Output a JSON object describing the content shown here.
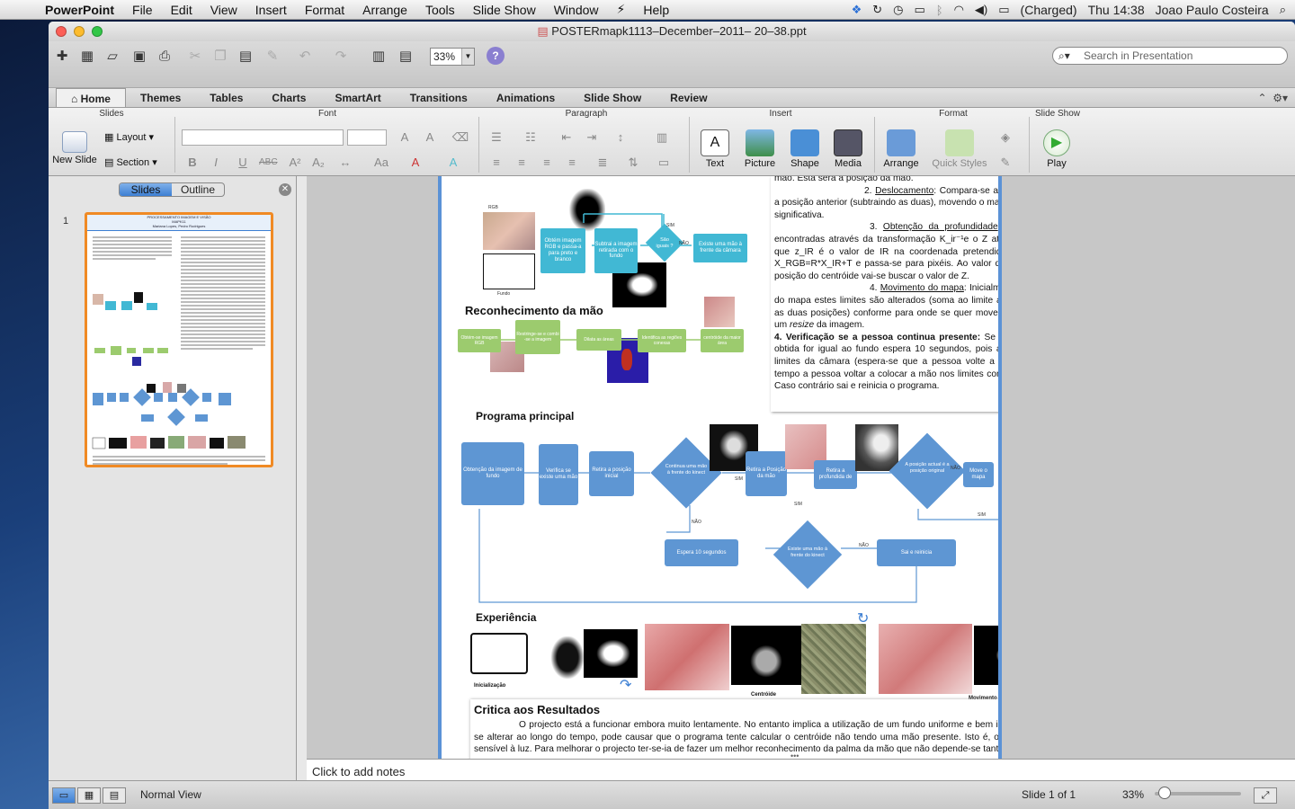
{
  "menubar": {
    "app": "PowerPoint",
    "items": [
      "File",
      "Edit",
      "View",
      "Insert",
      "Format",
      "Arrange",
      "Tools",
      "Slide Show",
      "Window",
      "Help"
    ],
    "battery": "(Charged)",
    "clock": "Thu 14:38",
    "user": "Joao Paulo Costeira"
  },
  "window": {
    "title": "POSTERmapk1113–December–2011– 20–38.ppt"
  },
  "toolbar": {
    "zoom": "33%",
    "search_placeholder": "Search in Presentation"
  },
  "tabs": [
    "Home",
    "Themes",
    "Tables",
    "Charts",
    "SmartArt",
    "Transitions",
    "Animations",
    "Slide Show",
    "Review"
  ],
  "ribbon": {
    "groups": {
      "slides": "Slides",
      "font": "Font",
      "paragraph": "Paragraph",
      "insert": "Insert",
      "format": "Format",
      "slideshow": "Slide Show"
    },
    "new_slide": "New Slide",
    "layout": "Layout",
    "section": "Section",
    "text": "Text",
    "picture": "Picture",
    "shape": "Shape",
    "media": "Media",
    "arrange": "Arrange",
    "quick_styles": "Quick Styles",
    "play": "Play"
  },
  "sidepanel": {
    "tab_slides": "Slides",
    "tab_outline": "Outline",
    "slide_number": "1"
  },
  "thumb": {
    "title": "PROCESSAMENTO IMAGEM E VISÃO",
    "subtitle": "MAPK11",
    "authors": "Mariana Lopes, Pedro Rodrigues"
  },
  "slide": {
    "right_text": {
      "line0": "mão. Esta será a posição da mão.",
      "p2_label": "2. ",
      "p2_title": "Deslocamento",
      "p2_body": ": Compara-se a posição actual da mão com a posição anterior (subtraindo as duas), movendo o mapa caso haja um deslocação significativa.",
      "p3_label": "3. ",
      "p3_title": "Obtenção da profundidade",
      "p3_body": ": As coordenadas X,Y são encontradas através da transformação K_ir⁻¹e o Z através de Z=1/(αz_IR+β) em que z_IR é o valor de IR na coordenada pretendida. Faz-se a transformação X_RGB=R*X_IR+T   e passa-se para pixéis. Ao valor de x,y que correspondente à posição do centróide vai-se buscar o valor de Z.",
      "p4_label": "4. ",
      "p4_title": "Movimento do mapa",
      "p4_body": ": Inicialmente é predefinido os limites do mapa estes limites são alterados (soma ao limite anterior, da subtracção entre as duas posições) conforme para onde se quer mover. O zoom é feito através de um ",
      "p4_italic": "resize",
      "p4_end": " da imagem.",
      "p5": "4. Verificação se a pessoa continua presente:",
      "p5_body": "  Se a imagem a preto e branco obtida for igual ao fundo espera 10 segundos, pois a mão poderá ter saído dos limites da câmara (espera-se que a pessoa volte a colocar), caso ao fim deste tempo a pessoa voltar a colocar a mão nos limites continua a calcular o centróide. Caso contrário sai e reinicia o programa."
    },
    "top_flow": {
      "rgb": "RGB",
      "fundo": "Fundo",
      "b1": "Obtém imagem RGB e passa-a para preto e branco",
      "b2": "Subtrai a imagem retirada com o fundo",
      "d1": "São iguais ?",
      "b3": "Existe uma mão à frente da câmara",
      "sim": "SIM",
      "nao": "NÃO"
    },
    "recon": {
      "title": "Reconhecimento da mão",
      "b1": "Obtém-se imagem RGB",
      "b2": "Restringe-se e combi -se a imagem",
      "b3": "Dilata as áreas",
      "b4": "Identifica as regiões conexas",
      "b5": "centróide da maior área"
    },
    "programa": {
      "title": "Programa principal",
      "b1": "Obtenção da imagem de fundo",
      "b2": "Verifica se existe uma mão",
      "b3": "Retira a posição inicial",
      "d1": "Continua uma mão à frente do kinect",
      "b4": "Retira a Posição da mão",
      "b5": "Retira a profundida de",
      "d2": "A posição actual é a posição original",
      "b6": "Move o mapa",
      "b7": "Posição anterior = Posição actual",
      "b8": "Espera 10 segundos",
      "d3": "Existe uma mão à frente do kinect",
      "b9": "Sai e reinicia",
      "sim": "SIM",
      "nao": "NÃO"
    },
    "experiencia": {
      "title": "Experiência",
      "l1": "Inicialização",
      "l2": "Centróide",
      "l3": "Movimento para Direita"
    },
    "critica": {
      "title": "Critica aos Resultados",
      "body": "O projecto está a funcionar embora muito lentamente. No entanto implica a utilização de um fundo uniforme e bem iluminado, senão se o fundo se alterar ao longo do tempo, pode causar que o programa tente calcular o centróide não tendo uma mão presente. Isto é, o programa é extremamente sensível à luz. Para melhorar o projecto ter-se-ia de fazer um melhor reconhecimento da palma da mão que não depende-se tanto da"
    }
  },
  "notes": {
    "placeholder": "Click to add notes"
  },
  "statusbar": {
    "view": "Normal View",
    "slide_info": "Slide 1 of 1",
    "zoom": "33%"
  },
  "colors": {
    "accent": "#3d7fd3",
    "flow_cyan": "#41b8d4",
    "flow_blue": "#5e96d3",
    "flow_green": "#9ccb6e",
    "thumb_border": "#f08a24"
  }
}
